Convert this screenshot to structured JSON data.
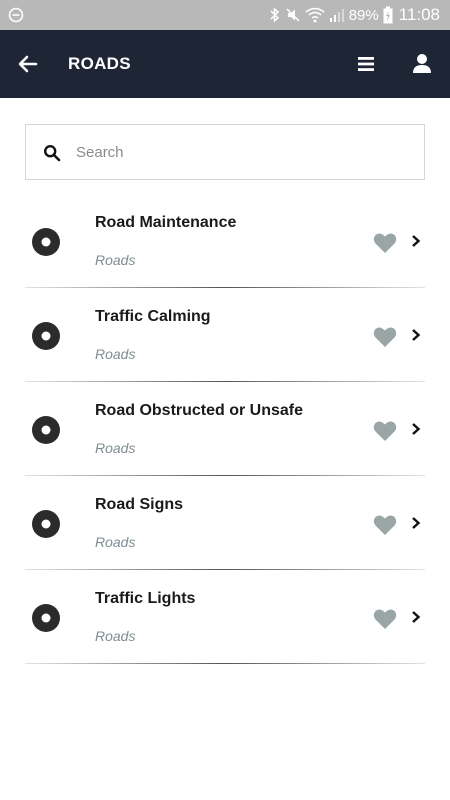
{
  "status_bar": {
    "battery": "89%",
    "time": "11:08"
  },
  "header": {
    "title": "ROADS",
    "back_icon": "arrow-left-icon",
    "menu_icon": "hamburger-menu-icon",
    "user_icon": "user-icon"
  },
  "search": {
    "placeholder": "Search",
    "value": ""
  },
  "list": {
    "items": [
      {
        "title": "Road Maintenance",
        "subtitle": "Roads"
      },
      {
        "title": "Traffic Calming",
        "subtitle": "Roads"
      },
      {
        "title": "Road Obstructed or Unsafe",
        "subtitle": "Roads"
      },
      {
        "title": "Road Signs",
        "subtitle": "Roads"
      },
      {
        "title": "Traffic Lights",
        "subtitle": "Roads"
      }
    ]
  },
  "colors": {
    "header_bg": "#1e2535",
    "status_bar_bg": "#b8b8b8",
    "heart": "#9aa6a6",
    "subtitle": "#7f8d92"
  }
}
